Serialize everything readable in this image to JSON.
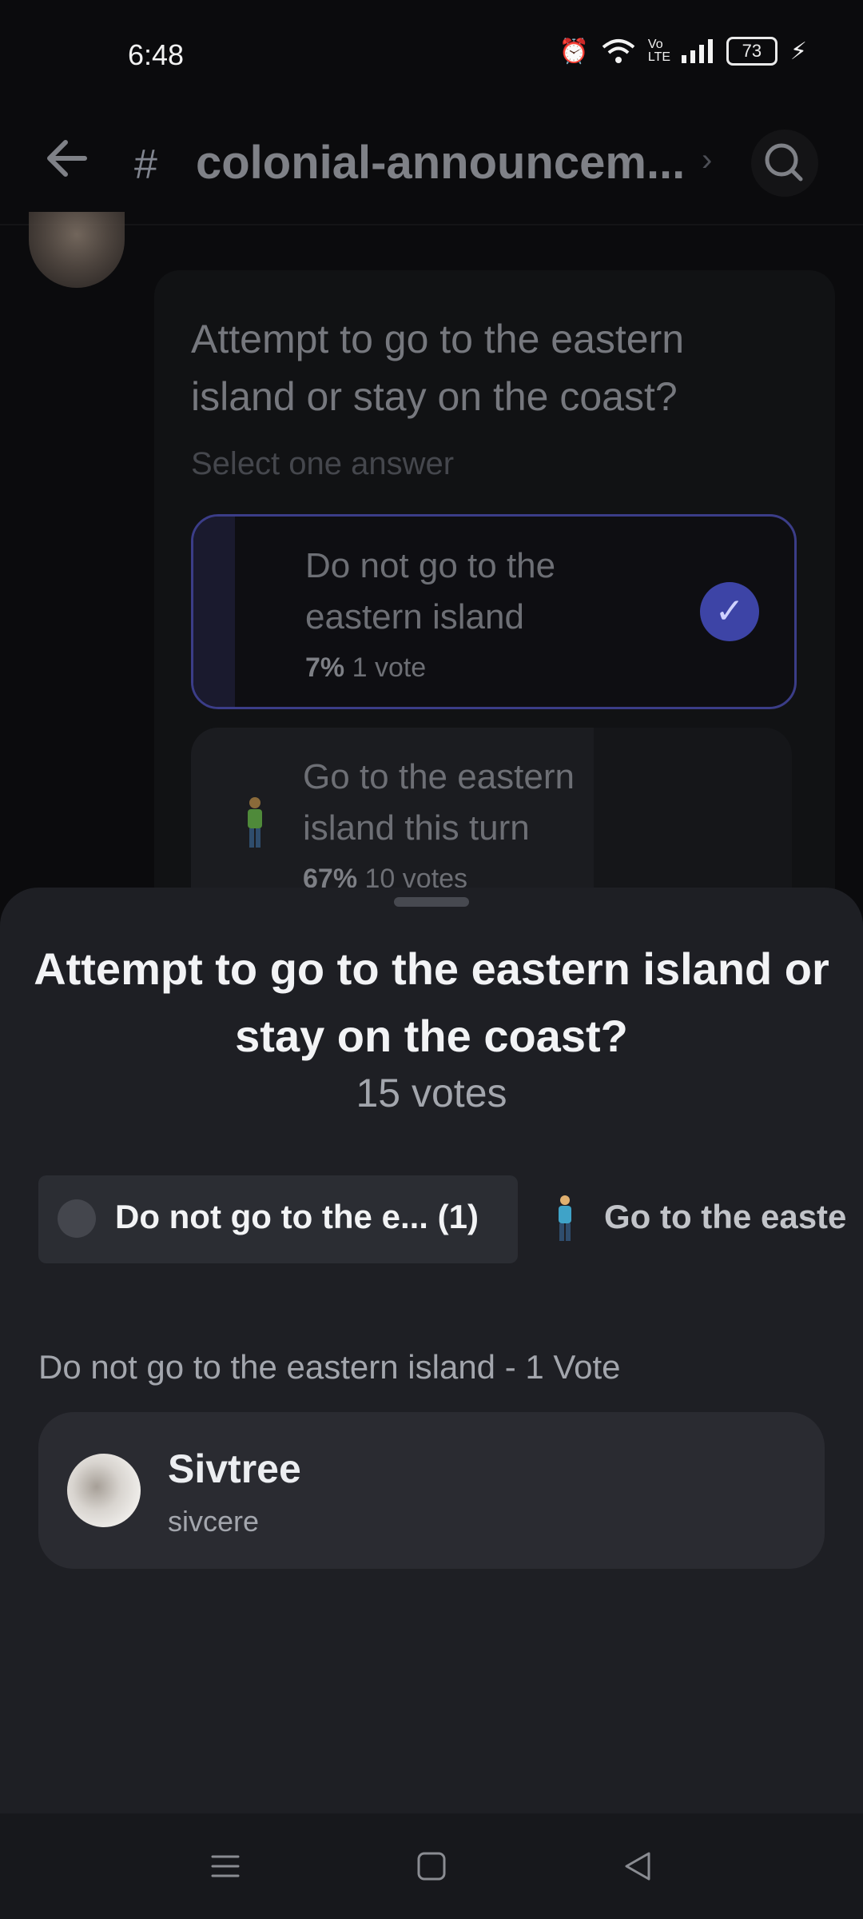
{
  "status_bar": {
    "time": "6:48",
    "network_label": "Vo LTE",
    "battery_level": "73"
  },
  "header": {
    "channel_name": "colonial-announcem...",
    "hash_symbol": "#",
    "chevron": "›"
  },
  "poll_card": {
    "question": "Attempt to go to the eastern island or stay on the coast?",
    "instruction": "Select one answer",
    "options": [
      {
        "text": "Do not go to the eastern island",
        "percent": "7%",
        "votes": "1 vote",
        "selected": true
      },
      {
        "text": "Go to the eastern island this turn",
        "percent": "67%",
        "votes": "10 votes",
        "selected": false
      }
    ]
  },
  "sheet": {
    "title": "Attempt to go to the eastern island or stay on the coast?",
    "total_votes": "15 votes",
    "tabs": [
      {
        "label": "Do not go to the e... (1)"
      },
      {
        "label": "Go to the easte"
      }
    ],
    "section_label": "Do not go to the eastern island - 1 Vote",
    "voters": [
      {
        "display_name": "Sivtree",
        "username": "sivcere"
      }
    ]
  },
  "colors": {
    "accent": "#3d44a6",
    "sheet_bg": "#1e1f24",
    "card_bg": "#2a2b31"
  },
  "icons": [
    "back-arrow-icon",
    "search-icon",
    "check-icon",
    "person-emoji-icon",
    "menu-icon",
    "home-icon",
    "back-triangle-icon"
  ]
}
